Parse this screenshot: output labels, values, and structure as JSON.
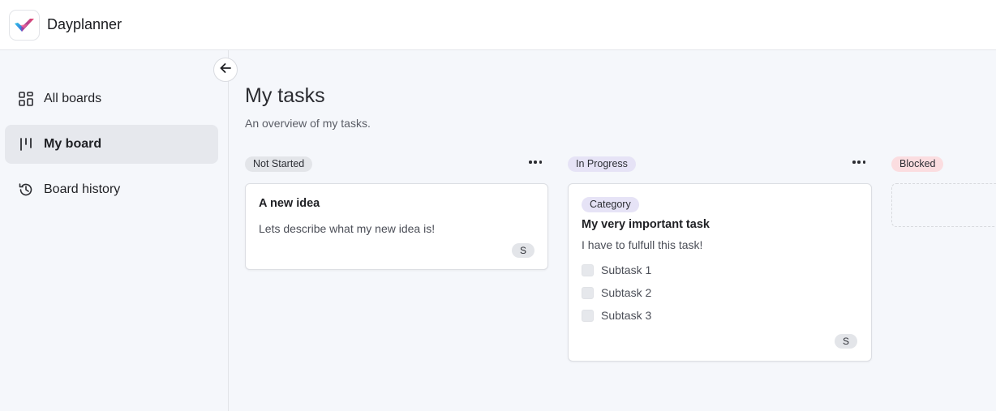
{
  "app": {
    "title": "Dayplanner"
  },
  "sidebar": {
    "items": [
      {
        "label": "All boards",
        "icon": "grid-icon"
      },
      {
        "label": "My board",
        "icon": "board-columns-icon",
        "active": true
      },
      {
        "label": "Board history",
        "icon": "history-icon"
      }
    ]
  },
  "page": {
    "title": "My tasks",
    "subtitle": "An overview of my tasks."
  },
  "columns": [
    {
      "name": "Not Started",
      "color": "#e3e5e9",
      "cards": [
        {
          "title": "A new idea",
          "description": "Lets describe what my new idea is!",
          "assignee": "S"
        }
      ]
    },
    {
      "name": "In Progress",
      "color": "#e6e3f6",
      "cards": [
        {
          "category": "Category",
          "title": "My very important task",
          "description": "I have to fulfull this task!",
          "subtasks": [
            {
              "label": "Subtask 1",
              "checked": false
            },
            {
              "label": "Subtask 2",
              "checked": false
            },
            {
              "label": "Subtask 3",
              "checked": false
            }
          ],
          "assignee": "S"
        }
      ]
    },
    {
      "name": "Blocked",
      "color": "#fbdde0",
      "cards": []
    }
  ]
}
